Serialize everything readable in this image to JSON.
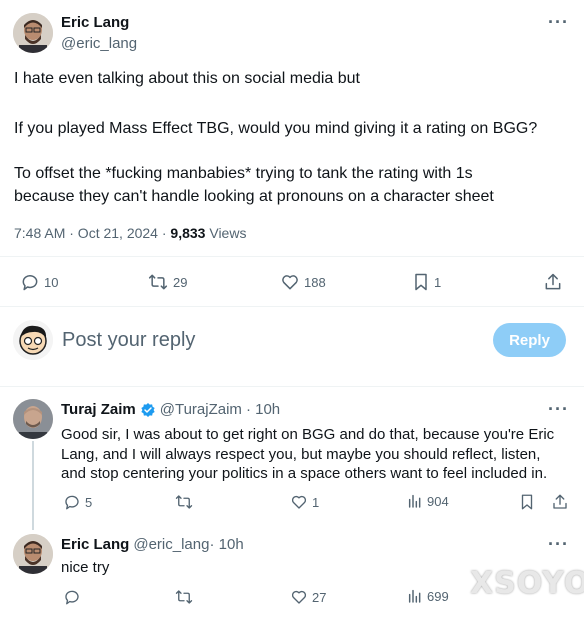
{
  "main_tweet": {
    "author_name": "Eric Lang",
    "author_handle": "@eric_lang",
    "text_lines": [
      "I hate even talking about this on social media but",
      "If you played Mass Effect TBG, would you mind giving it a rating on BGG?",
      "To offset the *fucking manbabies* trying to tank the rating with 1s",
      "because they can't handle looking at pronouns on a character sheet"
    ],
    "time": "7:48 AM · Oct 21, 2024 · ",
    "views_count": "9,833",
    "views_label": " Views",
    "actions": {
      "replies": "10",
      "retweets": "29",
      "likes": "188",
      "bookmarks": "1"
    }
  },
  "composer": {
    "placeholder": "Post your reply",
    "reply_button": "Reply"
  },
  "replies": [
    {
      "author_name": "Turaj Zaim",
      "author_handle": "@TurajZaim",
      "time": " · 10h",
      "text_lines": [
        "Good sir, I was about to get right on BGG and do that, because you're Eric",
        "Lang, and I will always respect you, but maybe you should reflect, listen,",
        "and stop centering your politics in a space others want to feel included in."
      ],
      "actions": {
        "replies": "5",
        "retweets": "",
        "likes": "1",
        "views": "904"
      }
    },
    {
      "author_name": "Eric Lang",
      "author_handle": "@eric_lang",
      "time": " · 10h",
      "text_lines": [
        "nice try"
      ],
      "actions": {
        "replies": "",
        "retweets": "",
        "likes": "27",
        "views": "699"
      }
    }
  ],
  "watermark": "XSOYO",
  "colors": {
    "accent": "#1d9bf0",
    "reply_button_disabled": "#8ecdf7",
    "muted": "#536471"
  }
}
